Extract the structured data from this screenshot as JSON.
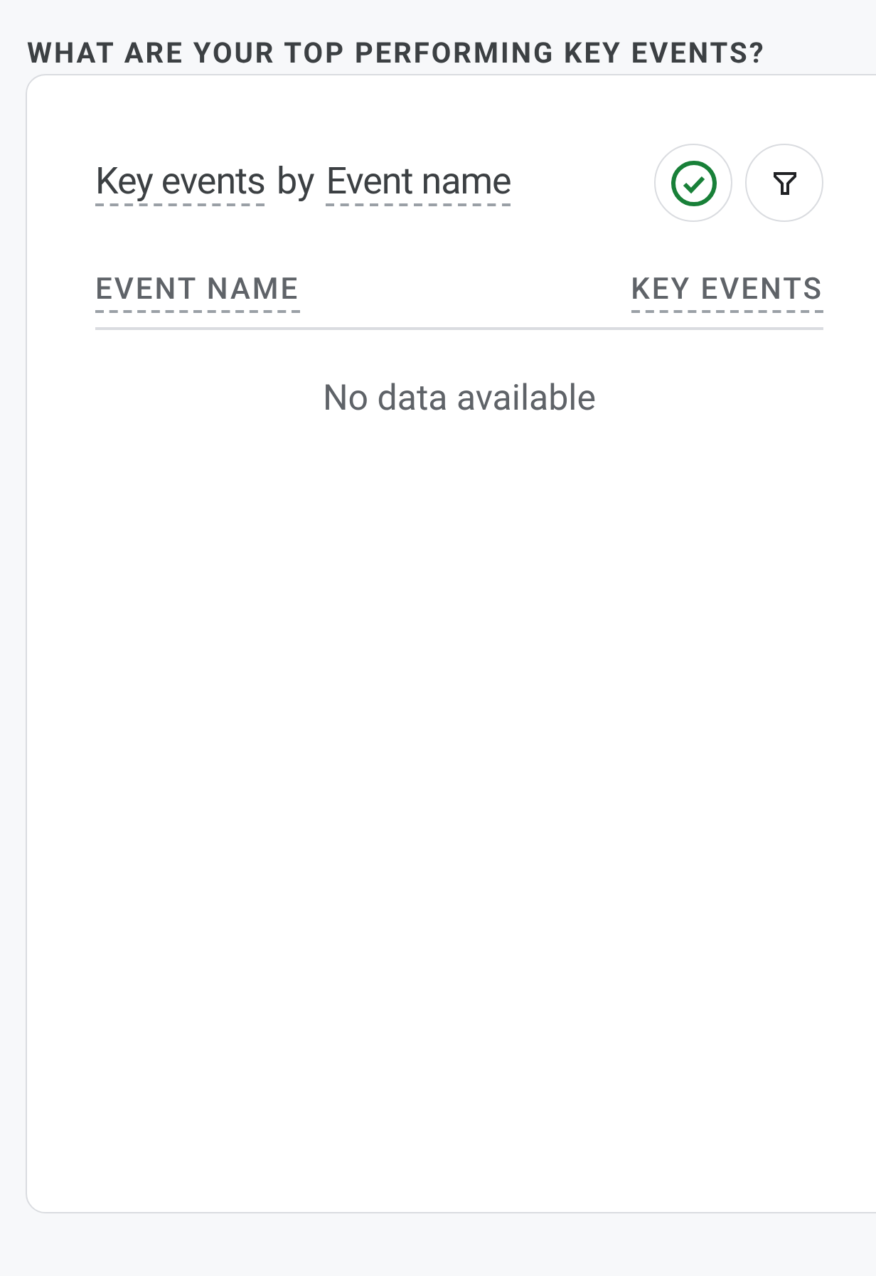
{
  "section_title": "WHAT ARE YOUR TOP PERFORMING KEY EVENTS?",
  "card": {
    "metric": "Key events",
    "connector": "by",
    "dimension": "Event name",
    "columns": [
      "EVENT NAME",
      "KEY EVENTS"
    ],
    "empty_message": "No data available"
  }
}
